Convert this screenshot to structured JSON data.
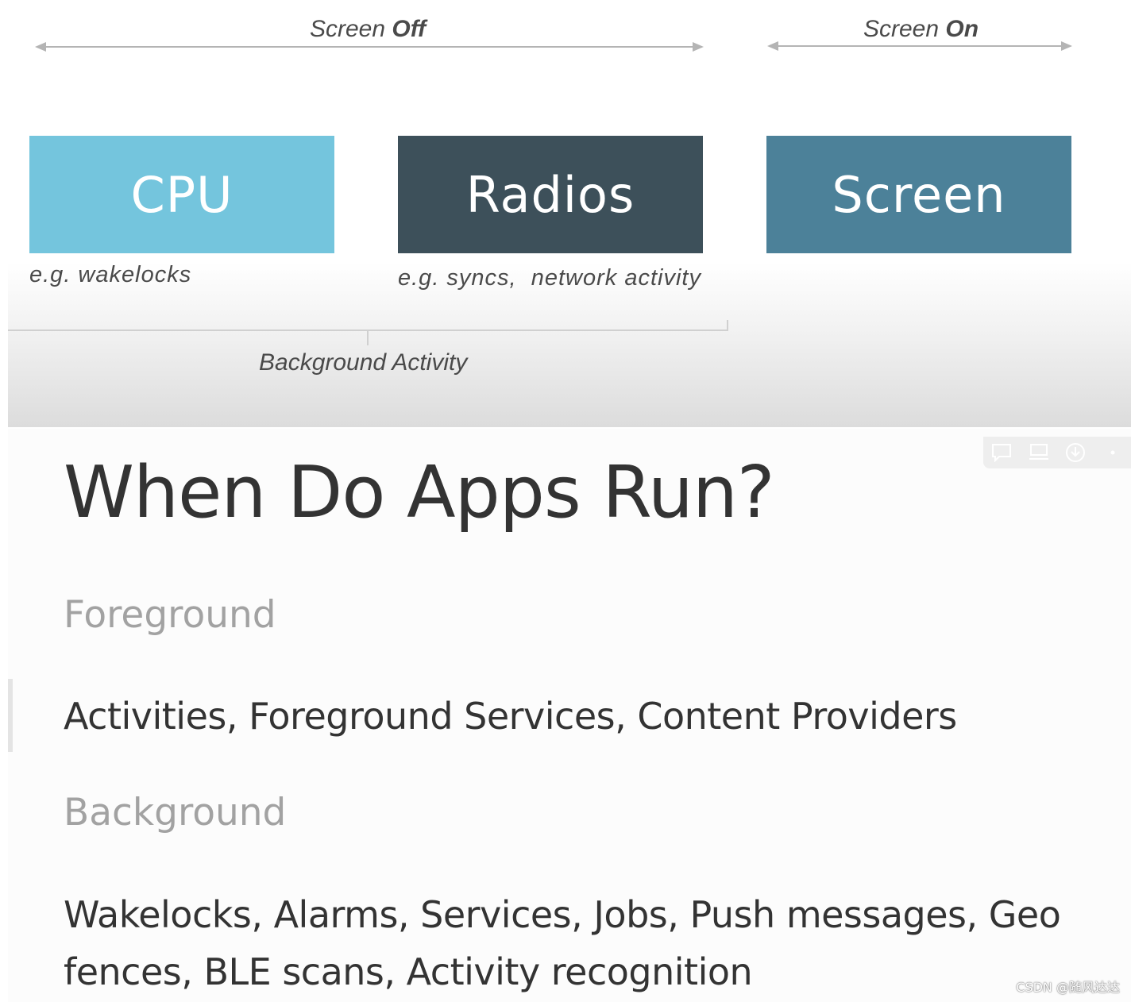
{
  "diagram": {
    "screen_off_prefix": "Screen ",
    "screen_off_strong": "Off",
    "screen_on_prefix": "Screen ",
    "screen_on_strong": "On",
    "blocks": [
      {
        "label": "CPU",
        "color": "#74c5dd"
      },
      {
        "label": "Radios",
        "color": "#3d505a"
      },
      {
        "label": "Screen",
        "color": "#4c8199"
      }
    ],
    "cpu_example": "e.g. wakelocks",
    "radios_example": "e.g. syncs,  network activity",
    "bracket_label": "Background Activity"
  },
  "slide": {
    "title": "When Do Apps Run?",
    "foreground_heading": "Foreground",
    "foreground_body": "Activities, Foreground Services, Content Providers",
    "background_heading": "Background",
    "background_body": "Wakelocks, Alarms, Services, Jobs, Push messages, Geo fences, BLE scans, Activity recognition"
  },
  "toolbar": {
    "icons": [
      "comment-icon",
      "screen-icon",
      "download-icon",
      "more-icon"
    ]
  },
  "watermark": "CSDN @随风达达"
}
